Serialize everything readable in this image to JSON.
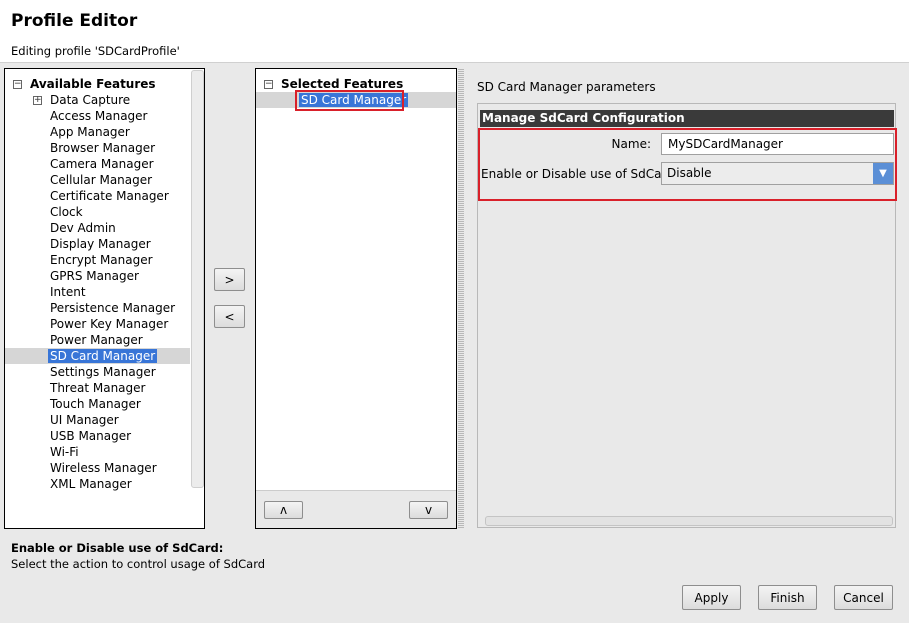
{
  "header": {
    "title": "Profile Editor",
    "subtitle": "Editing profile 'SDCardProfile'"
  },
  "available": {
    "root": "Available Features",
    "items": [
      "Data Capture",
      "Access Manager",
      "App Manager",
      "Browser Manager",
      "Camera Manager",
      "Cellular Manager",
      "Certificate Manager",
      "Clock",
      "Dev Admin",
      "Display Manager",
      "Encrypt Manager",
      "GPRS Manager",
      "Intent",
      "Persistence Manager",
      "Power Key Manager",
      "Power Manager",
      "SD Card Manager",
      "Settings Manager",
      "Threat Manager",
      "Touch Manager",
      "UI Manager",
      "USB Manager",
      "Wi-Fi",
      "Wireless Manager",
      "XML Manager"
    ],
    "selected": "SD Card Manager"
  },
  "transfer": {
    "add": ">",
    "remove": "<"
  },
  "selected_features": {
    "root": "Selected Features",
    "items": [
      "SD Card Manager"
    ],
    "move_up": "ʌ",
    "move_down": "v"
  },
  "params": {
    "title": "SD Card Manager parameters",
    "group": "Manage SdCard Configuration",
    "name_label": "Name:",
    "name_value": "MySDCardManager",
    "sdcard_label": "Enable or Disable use of SdCard:",
    "sdcard_value": "Disable"
  },
  "help": {
    "title": "Enable or Disable use of SdCard:",
    "text": "Select the action to control usage of SdCard"
  },
  "footer": {
    "apply": "Apply",
    "finish": "Finish",
    "cancel": "Cancel"
  },
  "colors": {
    "highlight": "#d9202a",
    "selection": "#3875d7",
    "group_header": "#3a3a3a"
  }
}
